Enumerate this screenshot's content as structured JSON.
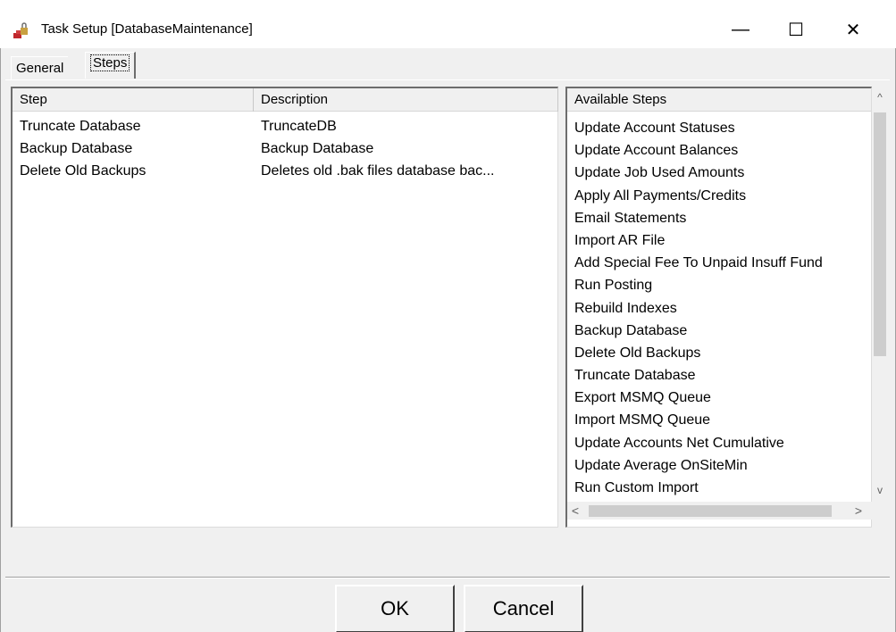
{
  "window": {
    "title": "Task Setup [DatabaseMaintenance]",
    "minimize": "—",
    "maximize": "☐",
    "close": "✕"
  },
  "tabs": [
    {
      "label": "General"
    },
    {
      "label": "Steps"
    }
  ],
  "steps_table": {
    "headers": {
      "step": "Step",
      "description": "Description"
    },
    "rows": [
      {
        "step": "Truncate Database",
        "description": "TruncateDB"
      },
      {
        "step": "Backup Database",
        "description": "Backup Database"
      },
      {
        "step": "Delete Old Backups",
        "description": "Deletes old .bak files database bac..."
      }
    ]
  },
  "available_steps": {
    "header": "Available Steps",
    "items": [
      "Update Account Statuses",
      "Update Account Balances",
      "Update Job Used Amounts",
      "Apply All Payments/Credits",
      "Email Statements",
      "Import AR File",
      "Add Special Fee To Unpaid Insuff Fund",
      "Run Posting",
      "Rebuild Indexes",
      "Backup Database",
      "Delete Old Backups",
      "Truncate Database",
      "Export MSMQ Queue",
      "Import MSMQ Queue",
      "Update Accounts Net Cumulative",
      "Update Average OnSiteMin",
      "Run Custom Import"
    ]
  },
  "scroll_glyphs": {
    "up": "^",
    "down": "v",
    "left": "<",
    "right": ">"
  },
  "buttons": {
    "ok": "OK",
    "cancel": "Cancel"
  },
  "colors": {
    "window_bg": "#f0f0f0",
    "list_bg": "#ffffff",
    "scroll_thumb": "#cdcdcd",
    "icon_red": "#c0282d"
  }
}
